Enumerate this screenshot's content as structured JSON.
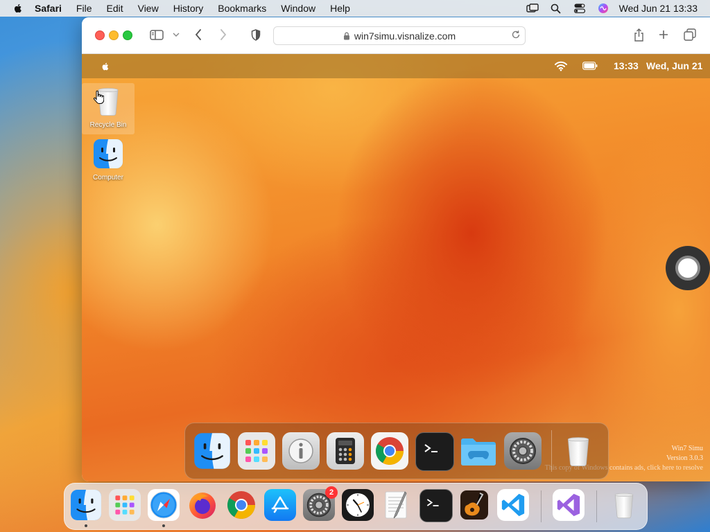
{
  "host_menubar": {
    "items": [
      "Safari",
      "File",
      "Edit",
      "View",
      "History",
      "Bookmarks",
      "Window",
      "Help"
    ],
    "clock": "Wed Jun 21  13:33",
    "status_icons": [
      "screen-mirroring-icon",
      "search-icon",
      "control-center-icon",
      "siri-icon"
    ]
  },
  "safari": {
    "url": "win7simu.visnalize.com",
    "toolbar_icons": [
      "sidebar-icon",
      "chevron-down-icon",
      "back-icon",
      "forward-icon",
      "privacy-shield-icon",
      "share-icon",
      "new-tab-icon",
      "tabs-overview-icon"
    ]
  },
  "guest": {
    "menubar": {
      "time": "13:33",
      "date": "Wed, Jun 21"
    },
    "desktop_icons": [
      {
        "label": "Recycle Bin",
        "icon": "recycle-bin-icon"
      },
      {
        "label": "Computer",
        "icon": "finder-icon"
      }
    ],
    "watermark": {
      "line1": "Win7 Simu",
      "line2": "Version 3.0.3",
      "line3": "This copy of Windows contains ads, click here to resolve"
    },
    "dock": [
      "finder-icon",
      "launchpad-icon",
      "info-icon",
      "calculator-icon",
      "chrome-icon",
      "terminal-icon",
      "games-folder-icon",
      "system-preferences-icon",
      "trash-icon"
    ]
  },
  "host_dock": {
    "apps": [
      "finder-icon",
      "launchpad-icon",
      "safari-icon",
      "firefox-icon",
      "chrome-icon",
      "app-store-icon",
      "system-settings-icon",
      "clock-icon",
      "textedit-icon",
      "terminal-icon",
      "garageband-icon",
      "vscode-icon",
      "visual-studio-icon",
      "trash-icon"
    ],
    "settings_badge": "2"
  },
  "colors": {
    "close": "#fe5f57",
    "minimize": "#febc2e",
    "zoom": "#28c840",
    "badge": "#ff3333"
  }
}
